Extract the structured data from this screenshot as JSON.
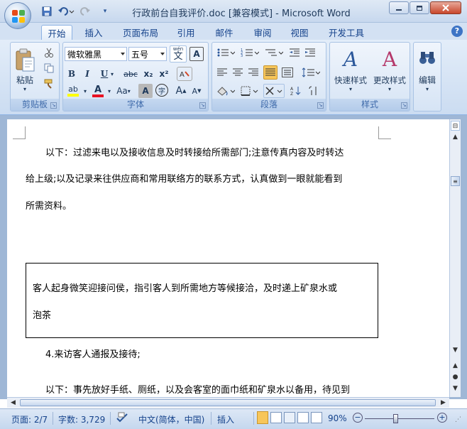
{
  "window": {
    "title": "行政前台自我评价.doc [兼容模式] - Microsoft Word",
    "min_icon": "minimize-icon",
    "restore_icon": "restore-icon",
    "close_icon": "close-icon"
  },
  "qat": {
    "save_icon": "save-icon",
    "undo_icon": "undo-icon",
    "redo_icon": "redo-icon"
  },
  "tabs": [
    {
      "label": "开始"
    },
    {
      "label": "插入"
    },
    {
      "label": "页面布局"
    },
    {
      "label": "引用"
    },
    {
      "label": "邮件"
    },
    {
      "label": "审阅"
    },
    {
      "label": "视图"
    },
    {
      "label": "开发工具"
    }
  ],
  "ribbon": {
    "clipboard": {
      "label": "剪贴板",
      "paste": "粘贴"
    },
    "font": {
      "label": "字体",
      "font_name": "微软雅黑",
      "font_size": "五号",
      "wen": "wén",
      "wen_char": "文",
      "a_char": "A",
      "bold": "B",
      "italic": "I",
      "underline": "U",
      "strike": "abc",
      "sub": "x₂",
      "sup": "x²",
      "change_case": "Aa",
      "grow": "A",
      "shrink": "A",
      "encircle": "字"
    },
    "paragraph": {
      "label": "段落"
    },
    "styles": {
      "label": "样式",
      "quick_styles": "快速样式",
      "change_styles": "更改样式",
      "letters": "A"
    },
    "editing": {
      "label": "编辑"
    }
  },
  "document": {
    "p1_line1": "以下：过滤来电以及接收信息及时转接给所需部门;注意传真内容及时转达",
    "p1_line2": "给上级;以及记录来往供应商和常用联络方的联系方式，认真做到一眼就能看到",
    "p1_line3": "所需资料。",
    "box_line1": "客人起身微笑迎接问侯，指引客人到所需地方等候接洽，及时递上矿泉水或",
    "box_line2": "泡茶",
    "p2": "4.来访客人通报及接待;",
    "p3": "以下：事先放好手纸、厕纸，以及会客室的面巾纸和矿泉水以备用，待见到"
  },
  "status": {
    "page": "页面: 2/7",
    "words": "字数: 3,729",
    "language": "中文(简体，中国)",
    "mode": "插入",
    "zoom": "90%",
    "zoom_level": 0.9
  },
  "colors": {
    "highlight": "#ffff00",
    "font_color": "#e81123",
    "accent": "#2b579a"
  }
}
